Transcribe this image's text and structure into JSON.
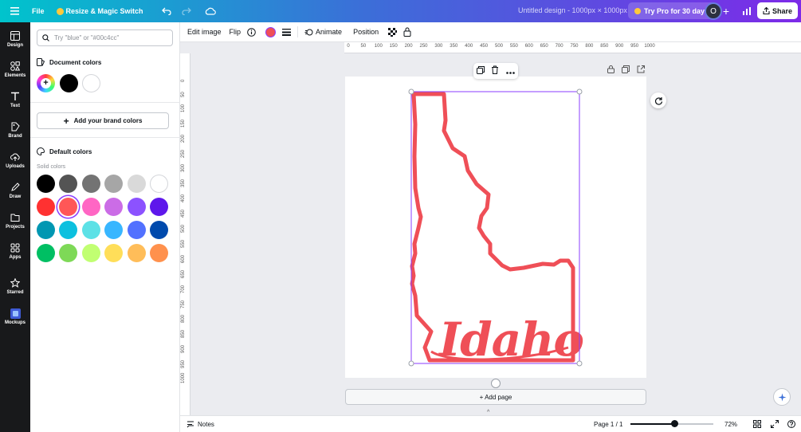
{
  "topbar": {
    "file_label": "File",
    "resize_label": "Resize & Magic Switch",
    "document_title": "Untitled design - 1000px × 1000px",
    "try_pro_label": "Try Pro for 30 days",
    "avatar_initial": "O",
    "share_label": "Share"
  },
  "rail": {
    "items": [
      {
        "label": "Design",
        "icon": "design-icon"
      },
      {
        "label": "Elements",
        "icon": "elements-icon"
      },
      {
        "label": "Text",
        "icon": "text-icon"
      },
      {
        "label": "Brand",
        "icon": "brand-icon"
      },
      {
        "label": "Uploads",
        "icon": "uploads-icon"
      },
      {
        "label": "Draw",
        "icon": "draw-icon"
      },
      {
        "label": "Projects",
        "icon": "projects-icon"
      },
      {
        "label": "Apps",
        "icon": "apps-icon"
      },
      {
        "label": "Starred",
        "icon": "star-icon"
      },
      {
        "label": "Mockups",
        "icon": "mockups-icon"
      }
    ]
  },
  "panel": {
    "search_placeholder": "Try \"blue\" or \"#00c4cc\"",
    "document_colors_heading": "Document colors",
    "document_colors": [
      "#000000",
      "#ffffff"
    ],
    "brand_button": "Add your brand colors",
    "default_colors_heading": "Default colors",
    "solid_colors_label": "Solid colors",
    "solid_colors": [
      "#000000",
      "#545454",
      "#737373",
      "#a6a6a6",
      "#d9d9d9",
      "#ffffff",
      "#ff3131",
      "#ff5757",
      "#ff66c4",
      "#cb6ce6",
      "#8c52ff",
      "#5e17eb",
      "#0097b2",
      "#0cc0df",
      "#5ce1e6",
      "#38b6ff",
      "#5271ff",
      "#004aad",
      "#00bf63",
      "#7ed957",
      "#c1ff72",
      "#ffde59",
      "#ffbd59",
      "#ff914d"
    ],
    "selected_color": "#ff5757"
  },
  "toolbar": {
    "edit_image": "Edit image",
    "flip": "Flip",
    "current_color": "#ef4f57",
    "animate": "Animate",
    "position": "Position"
  },
  "ruler": {
    "h_ticks": [
      "0",
      "50",
      "100",
      "150",
      "200",
      "250",
      "300",
      "350",
      "400",
      "450",
      "500",
      "550",
      "600",
      "650",
      "700",
      "750",
      "800",
      "850",
      "900",
      "950",
      "1000"
    ],
    "v_ticks": [
      "0",
      "50",
      "100",
      "150",
      "200",
      "250",
      "300",
      "350",
      "400",
      "450",
      "500",
      "550",
      "600",
      "650",
      "700",
      "750",
      "800",
      "850",
      "900",
      "950",
      "1000"
    ]
  },
  "canvas": {
    "artwork_text": "Idaho",
    "art_color": "#ef4f57",
    "selection_color": "#8b3dff"
  },
  "add_page_label": "+ Add page",
  "bottombar": {
    "notes_label": "Notes",
    "page_label": "Page 1 / 1",
    "zoom_label": "72%",
    "zoom_value": 0.72
  }
}
